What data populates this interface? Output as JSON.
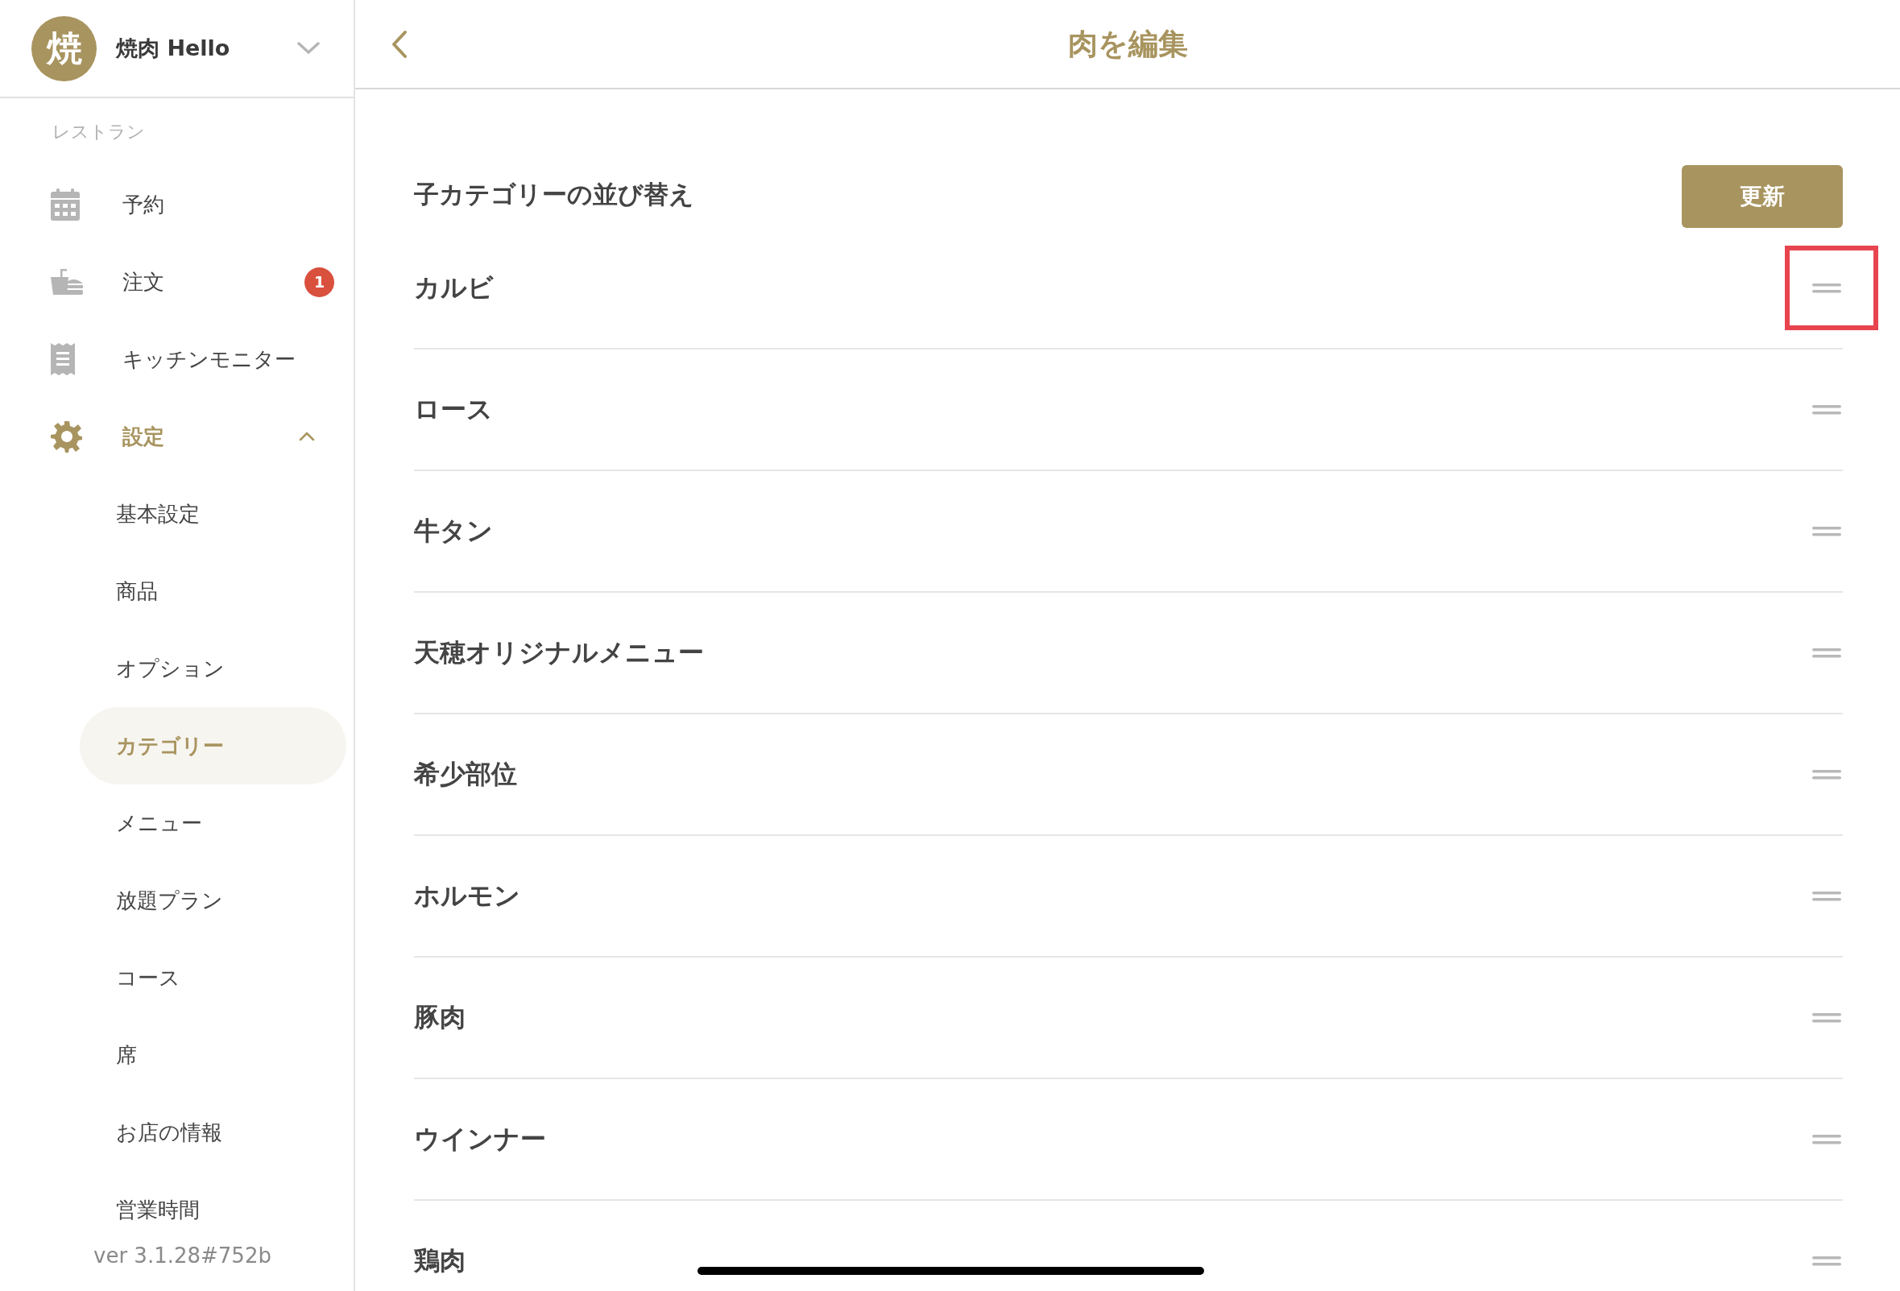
{
  "sidebar": {
    "store": {
      "avatar": "焼",
      "name": "焼肉 Hello"
    },
    "section_label": "レストラン",
    "items": [
      {
        "label": "予約",
        "selected": false
      },
      {
        "label": "注文",
        "selected": false,
        "badge": "1"
      },
      {
        "label": "キッチンモニター",
        "selected": false
      },
      {
        "label": "設定",
        "selected": true,
        "expanded": true,
        "children": [
          {
            "label": "基本設定",
            "selected": false
          },
          {
            "label": "商品",
            "selected": false
          },
          {
            "label": "オプション",
            "selected": false
          },
          {
            "label": "カテゴリー",
            "selected": true
          },
          {
            "label": "メニュー",
            "selected": false
          },
          {
            "label": "放題プラン",
            "selected": false
          },
          {
            "label": "コース",
            "selected": false
          },
          {
            "label": "席",
            "selected": false
          },
          {
            "label": "お店の情報",
            "selected": false
          },
          {
            "label": "営業時間",
            "selected": false
          }
        ]
      }
    ],
    "version": "ver 3.1.28#752b"
  },
  "header": {
    "title": "肉を編集"
  },
  "section": {
    "title": "子カテゴリーの並び替え",
    "button": "更新"
  },
  "rows": [
    {
      "name": "カルビ",
      "highlighted": true
    },
    {
      "name": "ロース",
      "highlighted": false
    },
    {
      "name": "牛タン",
      "highlighted": false
    },
    {
      "name": "天穂オリジナルメニュー",
      "highlighted": false
    },
    {
      "name": "希少部位",
      "highlighted": false
    },
    {
      "name": "ホルモン",
      "highlighted": false
    },
    {
      "name": "豚肉",
      "highlighted": false
    },
    {
      "name": "ウインナー",
      "highlighted": false
    },
    {
      "name": "鶏肉",
      "highlighted": false
    }
  ]
}
